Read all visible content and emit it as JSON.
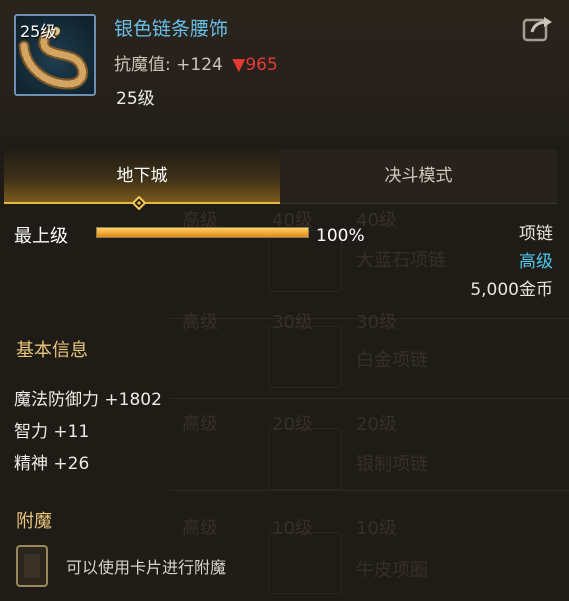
{
  "item": {
    "level_badge": "25级",
    "name": "银色链条腰饰",
    "stat_label": "抗魔值:",
    "stat_value": "+124",
    "stat_delta": "▼965",
    "level": "25级",
    "icon": "rope-belt-icon"
  },
  "share": {
    "icon": "share-icon"
  },
  "tabs": [
    {
      "label": "地下城",
      "active": true
    },
    {
      "label": "决斗模式",
      "active": false
    }
  ],
  "upgrade": {
    "label": "最上级",
    "percent_text": "100%",
    "progress": 1.0
  },
  "info": {
    "type": "项链",
    "rarity": "高级",
    "price": "5,000金币"
  },
  "basic_info": {
    "title": "基本信息",
    "attributes": [
      "魔法防御力 +1802",
      "智力 +11",
      "精神 +26"
    ]
  },
  "enchant": {
    "title": "附魔",
    "slot_text": "可以使用卡片进行附魔"
  },
  "background": {
    "ghost_entries": [
      {
        "rarity": "高级",
        "level": "40级",
        "name": "大蓝石项链"
      },
      {
        "rarity": "高级",
        "level": "30级",
        "name": "白金项链"
      },
      {
        "rarity": "高级",
        "level": "20级",
        "name": "银制项链"
      },
      {
        "rarity": "高级",
        "level": "10级",
        "name": "牛皮项圈"
      }
    ]
  },
  "colors": {
    "name": "#68c0e8",
    "delta": "#e53a33",
    "rarity": "#4ec8ec",
    "section": "#e8c67a",
    "tab_accent": "#e7b640"
  }
}
